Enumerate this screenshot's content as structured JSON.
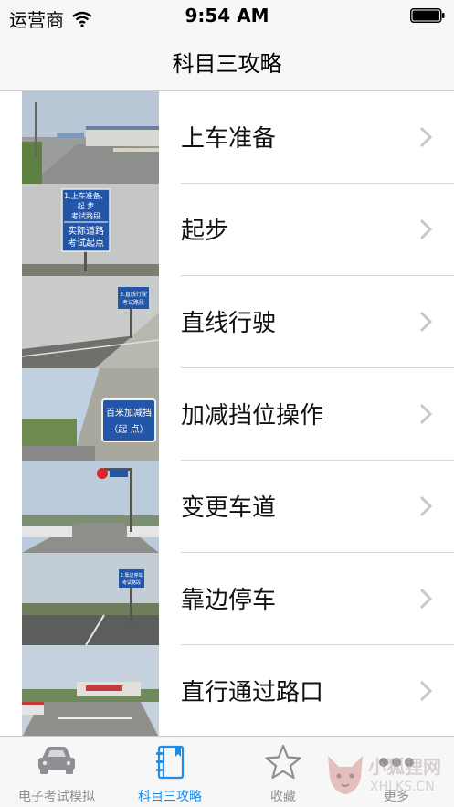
{
  "status_bar": {
    "carrier": "运营商",
    "time": "9:54 AM"
  },
  "nav": {
    "title": "科目三攻略"
  },
  "list": {
    "items": [
      {
        "label": "上车准备",
        "thumb": "road-with-building-photo"
      },
      {
        "label": "起步",
        "thumb": "start-sign-photo",
        "sign": [
          "1.上车准备、",
          "起 步",
          "考试路段",
          "实际道路",
          "考试起点"
        ]
      },
      {
        "label": "直线行驶",
        "thumb": "straight-road-wall-photo",
        "sign": [
          "3.直线行驶",
          "考试路段"
        ]
      },
      {
        "label": "加减挡位操作",
        "thumb": "gear-shift-sign-photo",
        "sign": [
          "百米加减挡",
          "（起 点）"
        ]
      },
      {
        "label": "变更车道",
        "thumb": "lane-change-road-photo"
      },
      {
        "label": "靠边停车",
        "thumb": "pull-over-road-photo",
        "sign": [
          "2.靠边停车",
          "考试路段"
        ]
      },
      {
        "label": "直行通过路口",
        "thumb": "intersection-photo"
      }
    ]
  },
  "tab_bar": {
    "tabs": [
      {
        "label": "电子考试模拟",
        "icon": "car-icon"
      },
      {
        "label": "科目三攻略",
        "icon": "book-icon",
        "active": true
      },
      {
        "label": "收藏",
        "icon": "star-icon"
      },
      {
        "label": "更多",
        "icon": "more-icon"
      }
    ]
  },
  "watermark": {
    "line1": "小狐狸网",
    "line2": "XHLKS.CN"
  },
  "colors": {
    "accent": "#1f8ce8",
    "inactive": "#8e8e93",
    "bar_bg": "#f7f7f7"
  }
}
